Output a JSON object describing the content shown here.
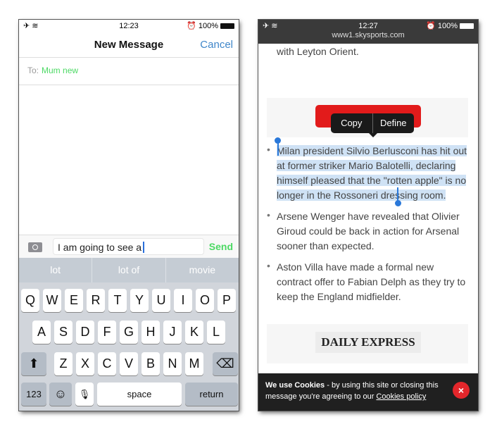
{
  "left": {
    "status": {
      "time": "12:23",
      "battery": "100%"
    },
    "nav": {
      "title": "New Message",
      "cancel": "Cancel"
    },
    "to": {
      "label": "To:",
      "recipient": "Mum new"
    },
    "input": {
      "value": "I am going to see a",
      "send": "Send"
    },
    "suggestions": [
      "lot",
      "lot of",
      "movie"
    ],
    "keyboard": {
      "row1": [
        "Q",
        "W",
        "E",
        "R",
        "T",
        "Y",
        "U",
        "I",
        "O",
        "P"
      ],
      "row2": [
        "A",
        "S",
        "D",
        "F",
        "G",
        "H",
        "J",
        "K",
        "L"
      ],
      "row3": [
        "Z",
        "X",
        "C",
        "V",
        "B",
        "N",
        "M"
      ],
      "numbers": "123",
      "space": "space",
      "return": "return"
    }
  },
  "right": {
    "status": {
      "time": "12:27",
      "battery": "100%"
    },
    "url": "www1.skysports.com",
    "intro": "chance of a quick return to management with Leyton Orient.",
    "menu": {
      "copy": "Copy",
      "define": "Define"
    },
    "bullets": [
      "Milan president Silvio Berlusconi has hit out at former striker Mario Balotelli, declaring himself pleased that the \"rotten apple\" is no longer in the Rossoneri dressing room.",
      "Arsene Wenger have revealed that Olivier Giroud could be back in action for Arsenal sooner than expected.",
      "Aston Villa have made a formal new contract offer to Fabian Delph as they try to keep the England midfielder."
    ],
    "ad_logo": "DAILY EXPRESS",
    "cookie": {
      "bold": "We use Cookies",
      "text": " - by using this site or closing this message you're agreeing to our ",
      "link": "Cookies policy",
      "close": "×"
    }
  }
}
